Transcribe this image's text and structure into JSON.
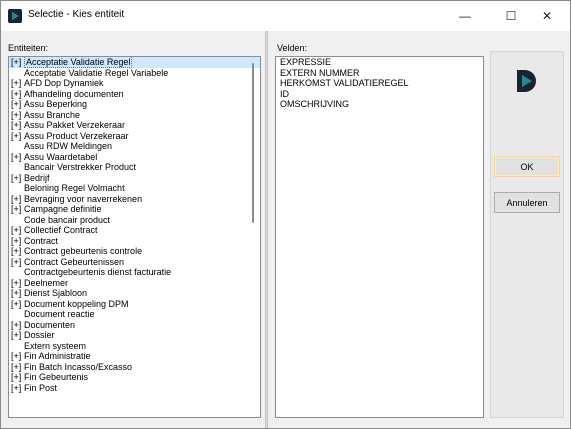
{
  "window": {
    "title": "Selectie - Kies entiteit",
    "minimize": "—",
    "maximize": "☐",
    "close": "✕"
  },
  "left": {
    "label": "Entiteiten:",
    "items": [
      {
        "exp": "[+]",
        "text": "Acceptatie Validatie Regel",
        "selected": true
      },
      {
        "exp": "",
        "text": "Acceptatie Validatie Regel Variabele"
      },
      {
        "exp": "[+]",
        "text": "AFD Dop Dynamiek"
      },
      {
        "exp": "[+]",
        "text": "Afhandeling documenten"
      },
      {
        "exp": "[+]",
        "text": "Assu Beperking"
      },
      {
        "exp": "[+]",
        "text": "Assu Branche"
      },
      {
        "exp": "[+]",
        "text": "Assu Pakket Verzekeraar"
      },
      {
        "exp": "[+]",
        "text": "Assu Product Verzekeraar"
      },
      {
        "exp": "",
        "text": "Assu RDW Meldingen"
      },
      {
        "exp": "[+]",
        "text": "Assu Waardetabel"
      },
      {
        "exp": "",
        "text": "Bancair Verstrekker Product"
      },
      {
        "exp": "[+]",
        "text": "Bedrijf"
      },
      {
        "exp": "",
        "text": "Beloning Regel Volmacht"
      },
      {
        "exp": "[+]",
        "text": "Bevraging voor naverrekenen"
      },
      {
        "exp": "[+]",
        "text": "Campagne definitie"
      },
      {
        "exp": "",
        "text": "Code bancair product"
      },
      {
        "exp": "[+]",
        "text": "Collectief Contract"
      },
      {
        "exp": "[+]",
        "text": "Contract"
      },
      {
        "exp": "[+]",
        "text": "Contract gebeurtenis controle"
      },
      {
        "exp": "[+]",
        "text": "Contract Gebeurtenissen"
      },
      {
        "exp": "",
        "text": "Contractgebeurtenis dienst facturatie"
      },
      {
        "exp": "[+]",
        "text": "Deelnemer"
      },
      {
        "exp": "[+]",
        "text": "Dienst Sjabloon"
      },
      {
        "exp": "[+]",
        "text": "Document koppeling DPM"
      },
      {
        "exp": "",
        "text": "Document reactie"
      },
      {
        "exp": "[+]",
        "text": "Documenten"
      },
      {
        "exp": "[+]",
        "text": "Dossier"
      },
      {
        "exp": "",
        "text": "Extern systeem"
      },
      {
        "exp": "[+]",
        "text": "Fin Administratie"
      },
      {
        "exp": "[+]",
        "text": "Fin Batch Incasso/Excasso"
      },
      {
        "exp": "[+]",
        "text": "Fin Gebeurtenis"
      },
      {
        "exp": "[+]",
        "text": "Fin Post"
      }
    ]
  },
  "right": {
    "label": "Velden:",
    "items": [
      "EXPRESSIE",
      "EXTERN NUMMER",
      "HERKOMST VALIDATIEREGEL",
      "ID",
      "OMSCHRIJVING"
    ]
  },
  "buttons": {
    "ok": "OK",
    "cancel": "Annuleren"
  },
  "colors": {
    "accent": "#1b8f8a",
    "logo_dark": "#1d2230",
    "selection": "#cde8ff"
  }
}
